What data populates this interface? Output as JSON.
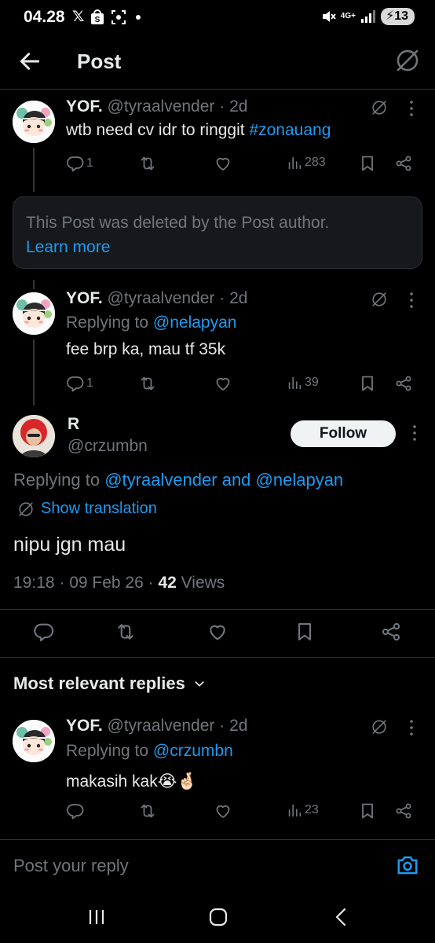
{
  "status_bar": {
    "time": "04.28",
    "network": "4G+",
    "battery": "13"
  },
  "header": {
    "title": "Post"
  },
  "tweets": [
    {
      "name": "YOF.",
      "handle": "@tyraalvender",
      "time": "· 2d",
      "text_plain": "wtb need cv idr to ringgit ",
      "hashtag": "#zonauang",
      "replies": "1",
      "views": "283"
    },
    {
      "name": "YOF.",
      "handle": "@tyraalvender",
      "time": "· 2d",
      "replying_prefix": "Replying to ",
      "replying_to": "@nelapyan",
      "text": "fee brp ka, mau tf 35k",
      "replies": "1",
      "views": "39"
    }
  ],
  "deleted_notice": {
    "text": "This Post was deleted by the Post author.",
    "link": "Learn more"
  },
  "main_post": {
    "name": "R",
    "handle": "@crzumbn",
    "follow_label": "Follow",
    "replying_prefix": "Replying to ",
    "replying_to_1": "@tyraalvender",
    "replying_and": " and ",
    "replying_to_2": "@nelapyan",
    "show_translation": "Show translation",
    "text": "nipu jgn mau",
    "timestamp": "19:18 · 09 Feb 26 · ",
    "views_count": "42",
    "views_label": " Views"
  },
  "replies_section": {
    "sort_label": "Most relevant replies"
  },
  "reply_tweet": {
    "name": "YOF.",
    "handle": "@tyraalvender",
    "time": "· 2d",
    "replying_prefix": "Replying to ",
    "replying_to": "@crzumbn",
    "text": "makasih kak😭🤞🏻",
    "views": "23"
  },
  "composer": {
    "placeholder": "Post your reply"
  },
  "colors": {
    "background": "#000000",
    "text_primary": "#e7e9ea",
    "text_secondary": "#71767b",
    "accent": "#1d9bf0",
    "divider": "#2f3336"
  },
  "icons": [
    "back-arrow-icon",
    "grok-icon",
    "more-icon",
    "reply-icon",
    "retweet-icon",
    "like-icon",
    "views-icon",
    "bookmark-icon",
    "share-icon",
    "camera-icon",
    "chevron-down-icon"
  ]
}
